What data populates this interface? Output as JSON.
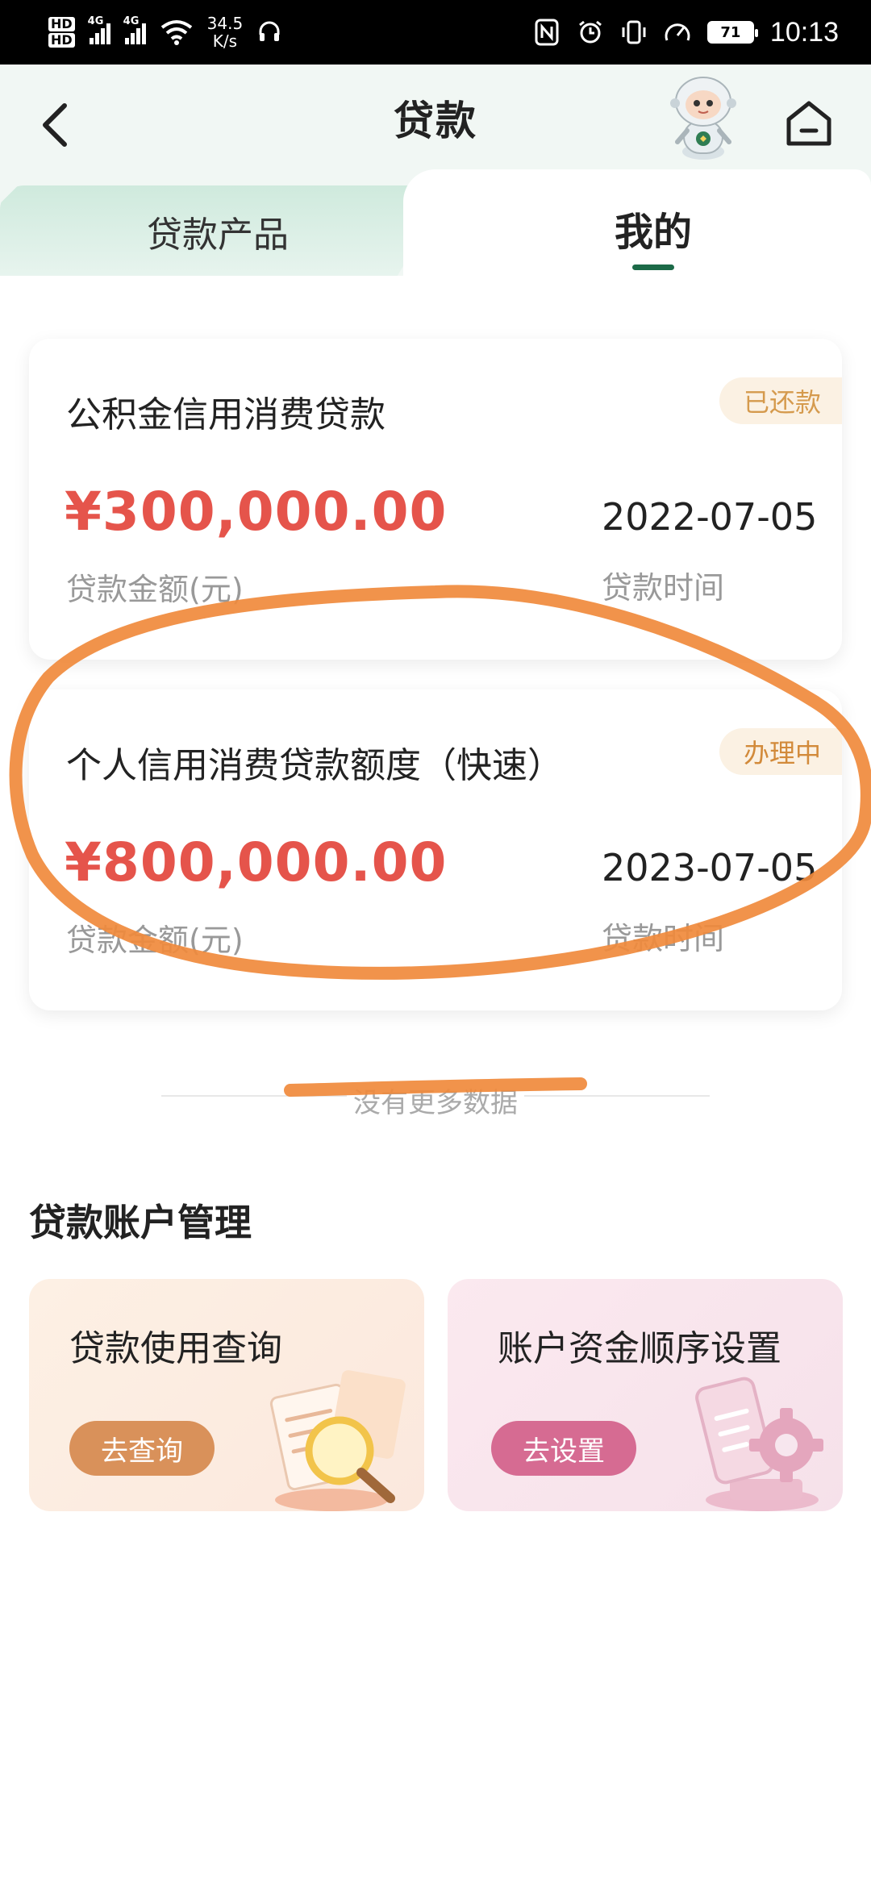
{
  "status_bar": {
    "hd1": "HD",
    "hd2": "HD",
    "network1": "4G",
    "network2": "4G",
    "speed_value": "34.5",
    "speed_unit": "K/s",
    "battery": "71",
    "time": "10:13"
  },
  "header": {
    "title": "贷款"
  },
  "tabs": {
    "left": "贷款产品",
    "right": "我的"
  },
  "loans": [
    {
      "name": "公积金信用消费贷款",
      "status": "已还款",
      "amount": "¥300,000.00",
      "amount_label": "贷款金额(元)",
      "date": "2022-07-05",
      "date_label": "贷款时间"
    },
    {
      "name": "个人信用消费贷款额度（快速）",
      "status": "办理中",
      "amount": "¥800,000.00",
      "amount_label": "贷款金额(元)",
      "date": "2023-07-05",
      "date_label": "贷款时间"
    }
  ],
  "no_more": "没有更多数据",
  "management": {
    "title": "贷款账户管理",
    "cards": [
      {
        "title": "贷款使用查询",
        "button": "去查询"
      },
      {
        "title": "账户资金顺序设置",
        "button": "去设置"
      }
    ]
  },
  "colors": {
    "accent_green": "#1c6a48",
    "amount_red": "#e5544b",
    "annotation_orange": "#f08a3c"
  }
}
